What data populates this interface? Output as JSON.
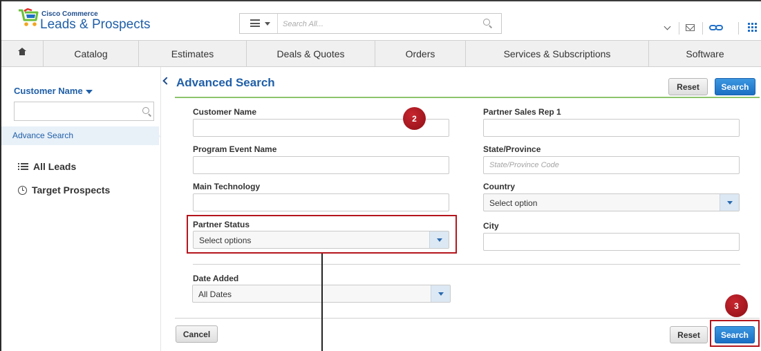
{
  "header": {
    "brand_small": "Cisco Commerce",
    "brand_title": "Leads & Prospects",
    "search_placeholder": "Search All...",
    "icons": [
      "menu-icon",
      "search-icon",
      "chevron-down-icon",
      "mail-icon",
      "link-icon",
      "apps-grid-icon"
    ]
  },
  "nav": {
    "items": [
      {
        "label": "",
        "icon": "home-icon"
      },
      {
        "label": "Catalog"
      },
      {
        "label": "Estimates"
      },
      {
        "label": "Deals & Quotes"
      },
      {
        "label": "Orders"
      },
      {
        "label": "Services & Subscriptions"
      },
      {
        "label": "Software"
      }
    ]
  },
  "sidebar": {
    "filter_label": "Customer Name",
    "search_value": "",
    "advance_search": "Advance Search",
    "items": [
      {
        "label": "All Leads",
        "icon": "list-icon"
      },
      {
        "label": "Target Prospects",
        "icon": "clock-icon"
      }
    ]
  },
  "main": {
    "title": "Advanced Search",
    "reset_label": "Reset",
    "search_label": "Search",
    "cancel_label": "Cancel",
    "fields": {
      "customer_name": {
        "label": "Customer Name",
        "value": ""
      },
      "program_event_name": {
        "label": "Program Event Name",
        "value": ""
      },
      "main_technology": {
        "label": "Main Technology",
        "value": ""
      },
      "partner_status": {
        "label": "Partner Status",
        "value": "Select options"
      },
      "partner_sales_rep": {
        "label": "Partner Sales Rep 1",
        "value": ""
      },
      "state_province": {
        "label": "State/Province",
        "placeholder": "State/Province Code",
        "value": ""
      },
      "country": {
        "label": "Country",
        "value": "Select option"
      },
      "city": {
        "label": "City",
        "value": ""
      },
      "date_added": {
        "label": "Date Added",
        "value": "All Dates"
      }
    }
  },
  "callouts": {
    "step2": "2",
    "step3": "3"
  },
  "colors": {
    "brand_blue": "#1f5fa8",
    "button_blue": "#1a6fc4",
    "divider_green": "#8cc46c",
    "callout_red": "#b4141c"
  }
}
